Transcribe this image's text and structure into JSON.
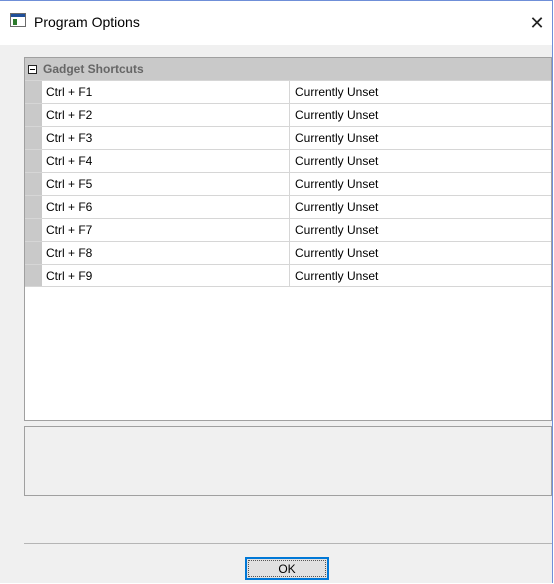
{
  "window": {
    "title": "Program Options",
    "close_glyph": "✕",
    "icon": "application-window-icon"
  },
  "property_grid": {
    "category": {
      "label": "Gadget Shortcuts",
      "expanded": true,
      "toggle_glyph": "minus-box-icon"
    },
    "rows": [
      {
        "name": "Ctrl + F1",
        "value": "Currently Unset"
      },
      {
        "name": "Ctrl + F2",
        "value": "Currently Unset"
      },
      {
        "name": "Ctrl + F3",
        "value": "Currently Unset"
      },
      {
        "name": "Ctrl + F4",
        "value": "Currently Unset"
      },
      {
        "name": "Ctrl + F5",
        "value": "Currently Unset"
      },
      {
        "name": "Ctrl + F6",
        "value": "Currently Unset"
      },
      {
        "name": "Ctrl + F7",
        "value": "Currently Unset"
      },
      {
        "name": "Ctrl + F8",
        "value": "Currently Unset"
      },
      {
        "name": "Ctrl + F9",
        "value": "Currently Unset"
      }
    ]
  },
  "description_pane": {
    "text": ""
  },
  "buttons": {
    "ok_label": "OK"
  },
  "colors": {
    "window_border": "#6f8fd8",
    "category_background": "#c9c9c9",
    "focus_border": "#0078d7"
  }
}
